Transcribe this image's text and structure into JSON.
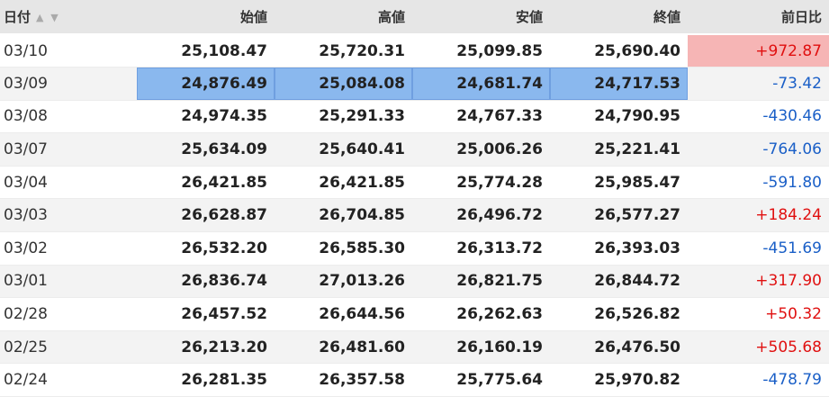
{
  "table": {
    "headers": {
      "date": "日付",
      "open": "始値",
      "high": "高値",
      "low": "安値",
      "close": "終値",
      "change": "前日比"
    },
    "sort_icons": "▲ ▼",
    "selected_row": "03/09",
    "highlighted_change_row": "03/10",
    "colors": {
      "up": "#e01010",
      "down": "#1a5fc7",
      "selection": "#8ab8ee",
      "highlight": "#f6b5b5"
    },
    "rows": [
      {
        "date": "03/10",
        "open": "25,108.47",
        "high": "25,720.31",
        "low": "25,099.85",
        "close": "25,690.40",
        "change": "+972.87",
        "direction": "up"
      },
      {
        "date": "03/09",
        "open": "24,876.49",
        "high": "25,084.08",
        "low": "24,681.74",
        "close": "24,717.53",
        "change": "-73.42",
        "direction": "down"
      },
      {
        "date": "03/08",
        "open": "24,974.35",
        "high": "25,291.33",
        "low": "24,767.33",
        "close": "24,790.95",
        "change": "-430.46",
        "direction": "down"
      },
      {
        "date": "03/07",
        "open": "25,634.09",
        "high": "25,640.41",
        "low": "25,006.26",
        "close": "25,221.41",
        "change": "-764.06",
        "direction": "down"
      },
      {
        "date": "03/04",
        "open": "26,421.85",
        "high": "26,421.85",
        "low": "25,774.28",
        "close": "25,985.47",
        "change": "-591.80",
        "direction": "down"
      },
      {
        "date": "03/03",
        "open": "26,628.87",
        "high": "26,704.85",
        "low": "26,496.72",
        "close": "26,577.27",
        "change": "+184.24",
        "direction": "up"
      },
      {
        "date": "03/02",
        "open": "26,532.20",
        "high": "26,585.30",
        "low": "26,313.72",
        "close": "26,393.03",
        "change": "-451.69",
        "direction": "down"
      },
      {
        "date": "03/01",
        "open": "26,836.74",
        "high": "27,013.26",
        "low": "26,821.75",
        "close": "26,844.72",
        "change": "+317.90",
        "direction": "up"
      },
      {
        "date": "02/28",
        "open": "26,457.52",
        "high": "26,644.56",
        "low": "26,262.63",
        "close": "26,526.82",
        "change": "+50.32",
        "direction": "up"
      },
      {
        "date": "02/25",
        "open": "26,213.20",
        "high": "26,481.60",
        "low": "26,160.19",
        "close": "26,476.50",
        "change": "+505.68",
        "direction": "up"
      },
      {
        "date": "02/24",
        "open": "26,281.35",
        "high": "26,357.58",
        "low": "25,775.64",
        "close": "25,970.82",
        "change": "-478.79",
        "direction": "down"
      }
    ]
  }
}
